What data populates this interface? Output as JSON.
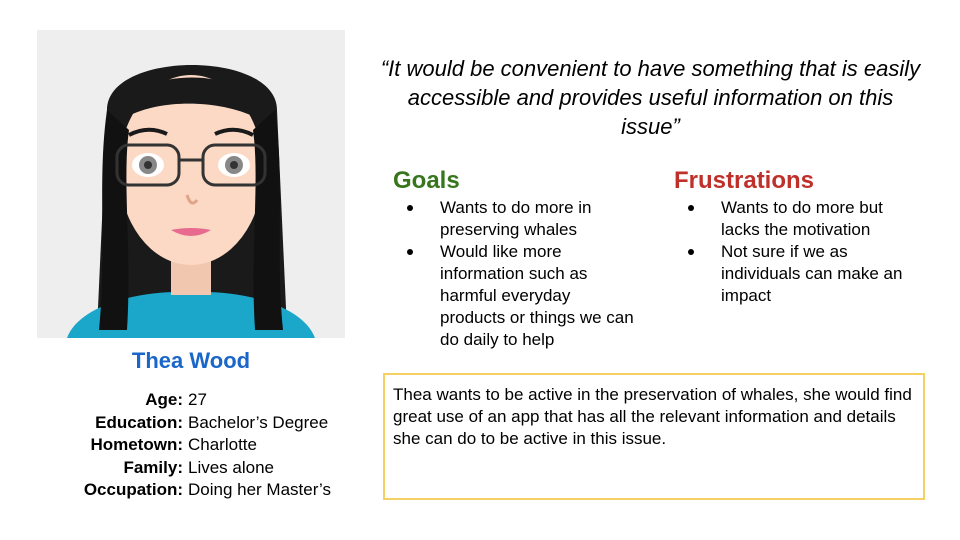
{
  "persona": {
    "name": "Thea Wood",
    "details": [
      {
        "label": "Age:",
        "value": "27"
      },
      {
        "label": "Education:",
        "value": "Bachelor’s Degree"
      },
      {
        "label": "Hometown:",
        "value": "Charlotte"
      },
      {
        "label": "Family:",
        "value": "Lives alone"
      },
      {
        "label": "Occupation:",
        "value": "Doing her Master’s"
      }
    ]
  },
  "quote": "“It would be convenient to have something that is easily accessible and provides useful information on this issue”",
  "goals": {
    "title": "Goals",
    "items": [
      "Wants to do more in preserving whales",
      "Would like more information such as harmful everyday products or things we can do daily to help"
    ]
  },
  "frustrations": {
    "title": "Frustrations",
    "items": [
      "Wants to do more but lacks the motivation",
      "Not sure if we as individuals can make an impact"
    ]
  },
  "summary": "Thea wants to be active in the preservation of whales, she would find great use of an app that has all the relevant information and details she can do to be active in this issue.",
  "colors": {
    "name": "#1a66c9",
    "goals": "#38761d",
    "frustrations": "#c0302b",
    "summary_border": "#f4d162",
    "shirt": "#1aa7c9",
    "hair": "#1a1a1a"
  },
  "icons": {
    "avatar": "persona-avatar-illustration"
  }
}
